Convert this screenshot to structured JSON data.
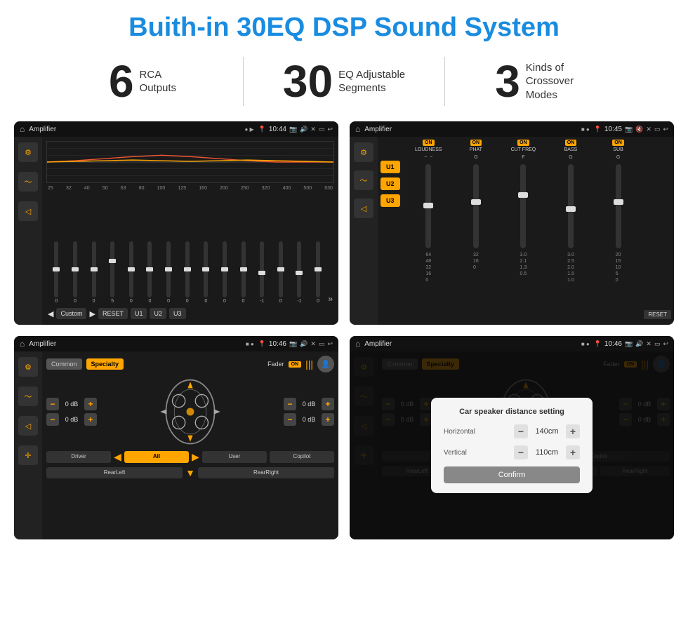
{
  "page": {
    "title": "Buith-in 30EQ DSP Sound System"
  },
  "stats": [
    {
      "number": "6",
      "line1": "RCA",
      "line2": "Outputs"
    },
    {
      "number": "30",
      "line1": "EQ Adjustable",
      "line2": "Segments"
    },
    {
      "number": "3",
      "line1": "Kinds of",
      "line2": "Crossover Modes"
    }
  ],
  "screens": [
    {
      "id": "screen1",
      "status_bar": {
        "time": "10:44",
        "title": "Amplifier"
      },
      "type": "eq"
    },
    {
      "id": "screen2",
      "status_bar": {
        "time": "10:45",
        "title": "Amplifier"
      },
      "type": "amp"
    },
    {
      "id": "screen3",
      "status_bar": {
        "time": "10:46",
        "title": "Amplifier"
      },
      "type": "fader"
    },
    {
      "id": "screen4",
      "status_bar": {
        "time": "10:46",
        "title": "Amplifier"
      },
      "type": "fader_dialog"
    }
  ],
  "eq": {
    "freqs": [
      "25",
      "32",
      "40",
      "50",
      "63",
      "80",
      "100",
      "125",
      "160",
      "200",
      "250",
      "320",
      "400",
      "500",
      "630"
    ],
    "values": [
      "0",
      "0",
      "0",
      "5",
      "0",
      "0",
      "0",
      "0",
      "0",
      "0",
      "0",
      "-1",
      "0",
      "-1"
    ],
    "preset": "Custom",
    "buttons": [
      "RESET",
      "U1",
      "U2",
      "U3"
    ]
  },
  "amp": {
    "u_buttons": [
      "U1",
      "U2",
      "U3"
    ],
    "bands": [
      {
        "label": "LOUDNESS",
        "on": true
      },
      {
        "label": "PHAT",
        "on": true
      },
      {
        "label": "CUT FREQ",
        "on": true
      },
      {
        "label": "BASS",
        "on": true
      },
      {
        "label": "SUB",
        "on": true
      }
    ],
    "reset": "RESET"
  },
  "fader": {
    "tabs": [
      "Common",
      "Specialty"
    ],
    "active_tab": "Specialty",
    "fader_label": "Fader",
    "on": "ON",
    "channels": [
      {
        "label": "0 dB"
      },
      {
        "label": "0 dB"
      },
      {
        "label": "0 dB"
      },
      {
        "label": "0 dB"
      }
    ],
    "nav_buttons": [
      "Driver",
      "Copilot",
      "RearLeft",
      "All",
      "User",
      "RearRight"
    ]
  },
  "dialog": {
    "title": "Car speaker distance setting",
    "horizontal_label": "Horizontal",
    "horizontal_value": "140cm",
    "vertical_label": "Vertical",
    "vertical_value": "110cm",
    "confirm_label": "Confirm"
  }
}
